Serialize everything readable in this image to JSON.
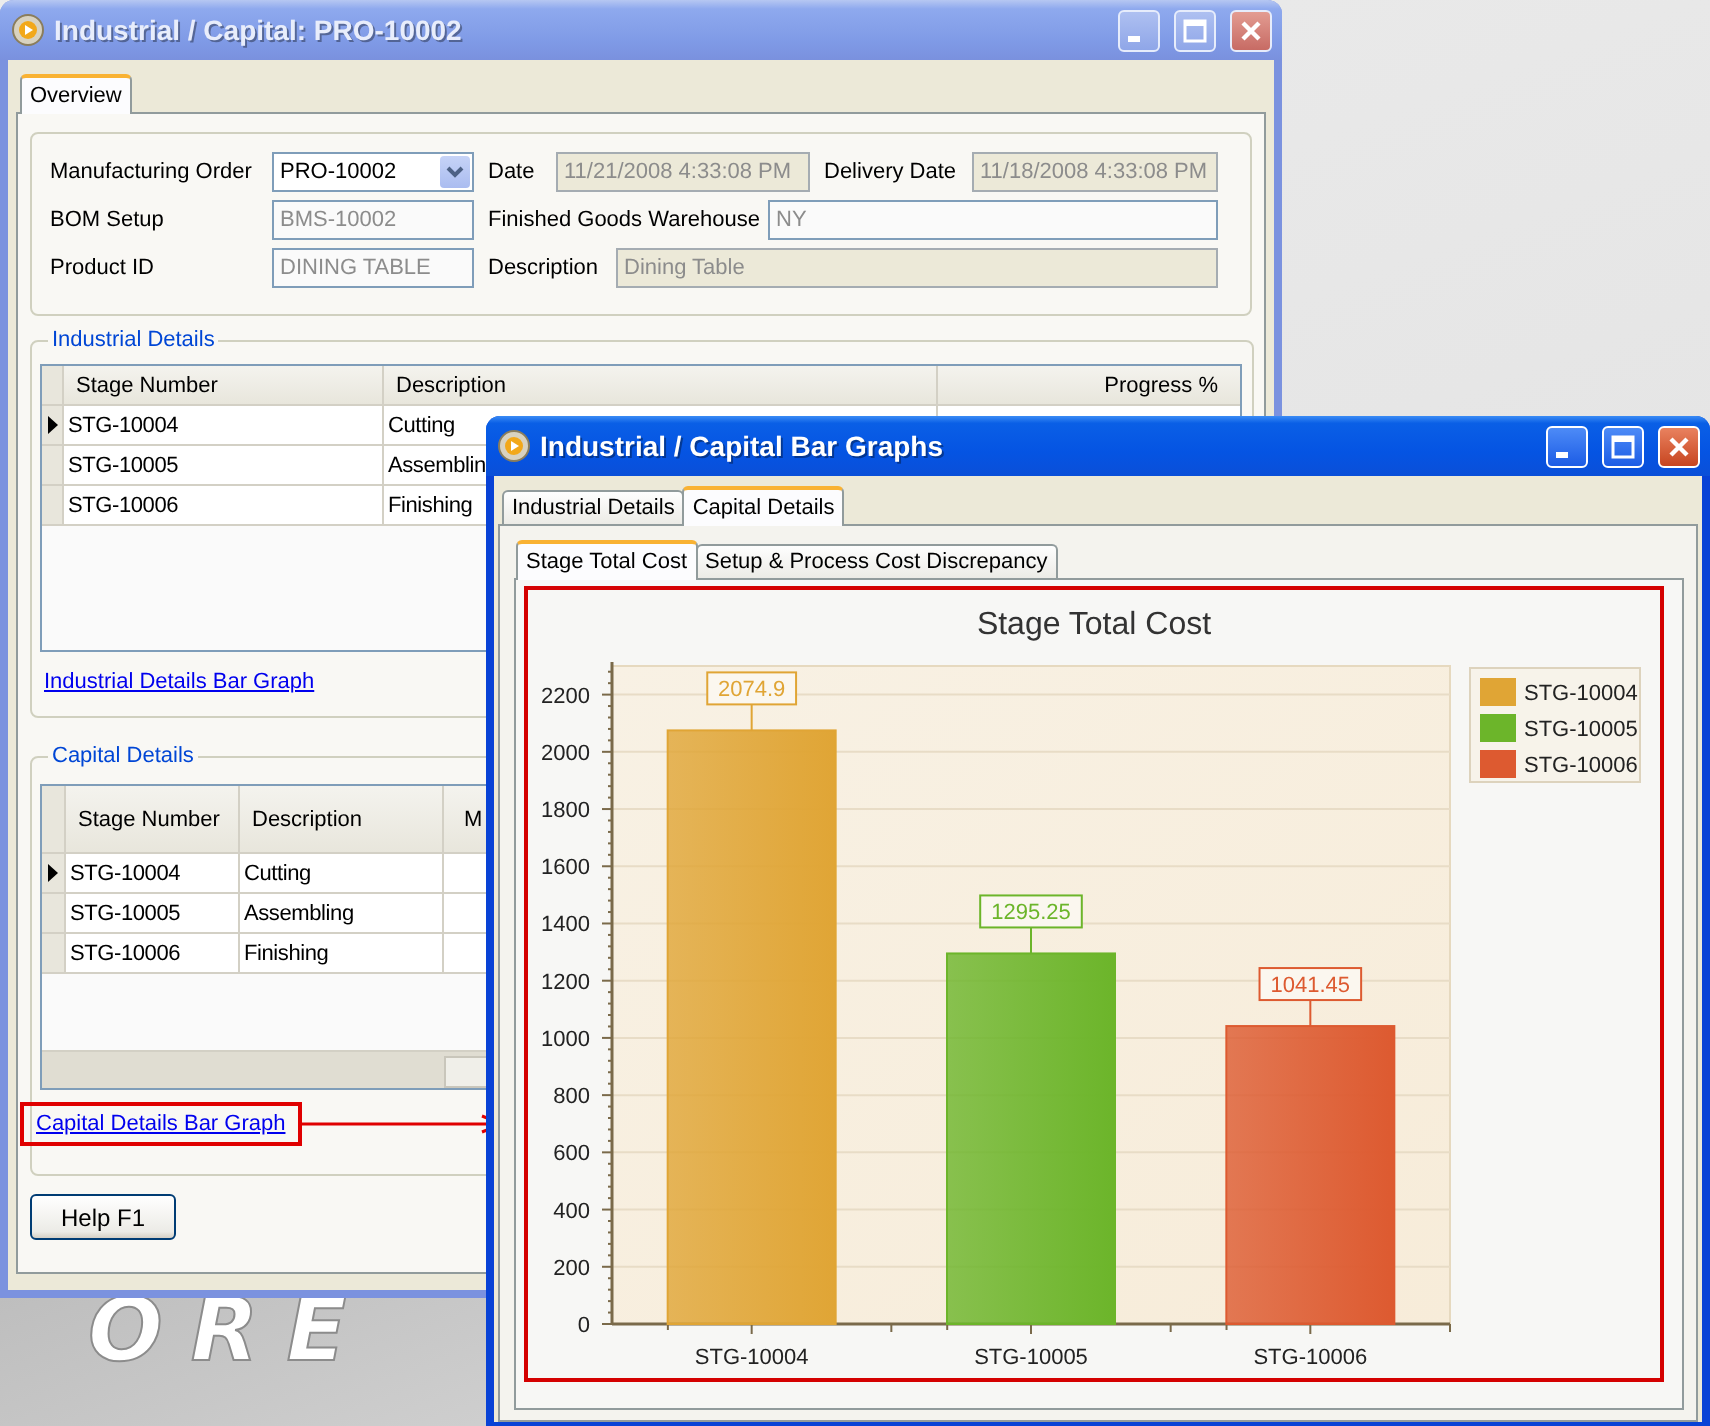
{
  "main_window": {
    "title": "Industrial / Capital: PRO-10002",
    "active": false,
    "tabs": [
      {
        "label": "Overview",
        "selected": true
      }
    ],
    "field_rows": [
      [
        {
          "label": "Manufacturing Order",
          "value": "PRO-10002",
          "kind": "dropdown"
        },
        {
          "label": "Date",
          "value": "11/21/2008 4:33:08 PM",
          "kind": "readonly"
        },
        {
          "label": "Delivery Date",
          "value": "11/18/2008 4:33:08 PM",
          "kind": "readonly"
        }
      ],
      [
        {
          "label": "BOM Setup",
          "value": "BMS-10002",
          "kind": "text"
        },
        {
          "label": "Finished Goods Warehouse",
          "value": "NY",
          "kind": "text"
        }
      ],
      [
        {
          "label": "Product ID",
          "value": "DINING TABLE",
          "kind": "text"
        },
        {
          "label": "Description",
          "value": "Dining Table",
          "kind": "readonly"
        }
      ]
    ],
    "industrial_details": {
      "title": "Industrial Details",
      "columns": [
        "Stage Number",
        "Description",
        "Progress %"
      ],
      "rows": [
        {
          "cells": [
            "STG-10004",
            "Cutting"
          ],
          "selected": true
        },
        {
          "cells": [
            "STG-10005",
            "Assemblin"
          ],
          "selected": false
        },
        {
          "cells": [
            "STG-10006",
            "Finishing"
          ],
          "selected": false
        }
      ],
      "link": {
        "label": "Industrial Details Bar Graph",
        "highlighted": false
      }
    },
    "capital_details": {
      "title": "Capital Details",
      "columns": [
        "Stage Number",
        "Description",
        "M"
      ],
      "rows": [
        {
          "cells": [
            "STG-10004",
            "Cutting"
          ],
          "selected": true
        },
        {
          "cells": [
            "STG-10005",
            "Assembling"
          ],
          "selected": false
        },
        {
          "cells": [
            "STG-10006",
            "Finishing"
          ],
          "selected": false
        }
      ],
      "link": {
        "label": "Capital Details Bar Graph",
        "highlighted": true
      }
    },
    "help_button": "Help F1"
  },
  "graph_window": {
    "title": "Industrial / Capital Bar Graphs",
    "active": true,
    "tabs": [
      {
        "label": "Industrial Details",
        "selected": false
      },
      {
        "label": "Capital Details",
        "selected": true
      }
    ],
    "subtabs": [
      {
        "label": "Stage Total Cost",
        "selected": true
      },
      {
        "label": "Setup & Process Cost Discrepancy",
        "selected": false
      }
    ],
    "chart_data": {
      "type": "bar",
      "title": "Stage Total Cost",
      "categories": [
        "STG-10004",
        "STG-10005",
        "STG-10006"
      ],
      "series": [
        {
          "name": "STG-10004",
          "color": "#e0a535",
          "values": [
            2074.9,
            null,
            null
          ]
        },
        {
          "name": "STG-10005",
          "color": "#6cb52a",
          "values": [
            null,
            1295.25,
            null
          ]
        },
        {
          "name": "STG-10006",
          "color": "#dd5a30",
          "values": [
            null,
            null,
            1041.45
          ]
        }
      ],
      "ylim": [
        0,
        2300
      ],
      "yticks": [
        0,
        200,
        400,
        600,
        800,
        1000,
        1200,
        1400,
        1600,
        1800,
        2000,
        2200
      ],
      "data_labels": true,
      "grid": true,
      "legend": "right"
    }
  },
  "wallpaper_text": "ORE"
}
